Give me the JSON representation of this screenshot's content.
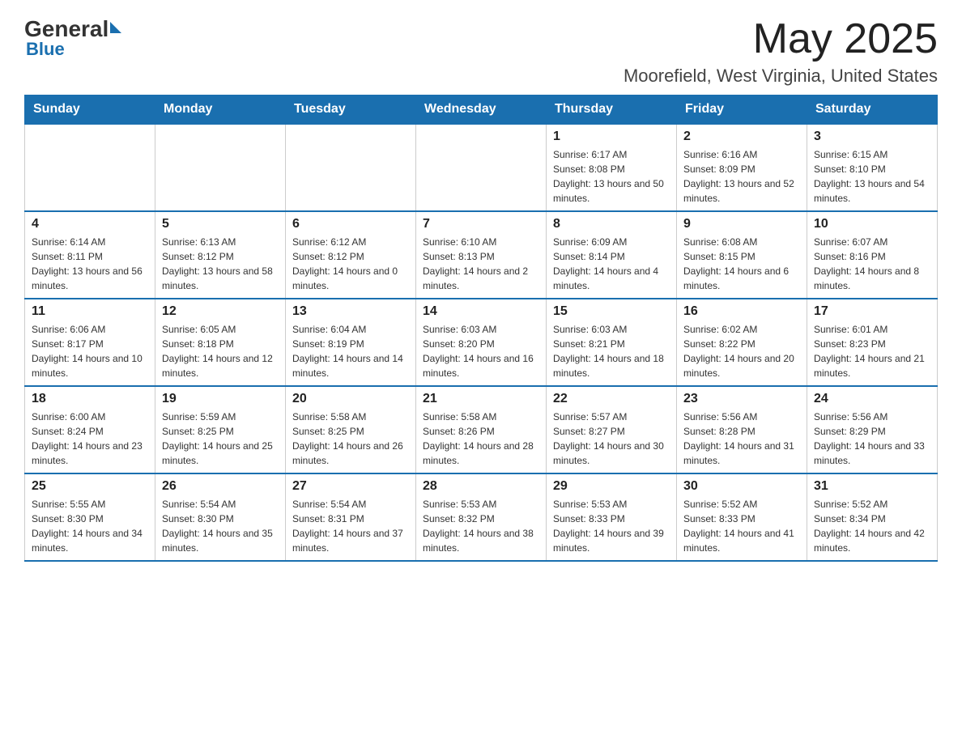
{
  "header": {
    "logo_general": "General",
    "logo_blue": "Blue",
    "month_title": "May 2025",
    "location": "Moorefield, West Virginia, United States"
  },
  "days_of_week": [
    "Sunday",
    "Monday",
    "Tuesday",
    "Wednesday",
    "Thursday",
    "Friday",
    "Saturday"
  ],
  "weeks": [
    [
      {
        "day": "",
        "info": ""
      },
      {
        "day": "",
        "info": ""
      },
      {
        "day": "",
        "info": ""
      },
      {
        "day": "",
        "info": ""
      },
      {
        "day": "1",
        "info": "Sunrise: 6:17 AM\nSunset: 8:08 PM\nDaylight: 13 hours and 50 minutes."
      },
      {
        "day": "2",
        "info": "Sunrise: 6:16 AM\nSunset: 8:09 PM\nDaylight: 13 hours and 52 minutes."
      },
      {
        "day": "3",
        "info": "Sunrise: 6:15 AM\nSunset: 8:10 PM\nDaylight: 13 hours and 54 minutes."
      }
    ],
    [
      {
        "day": "4",
        "info": "Sunrise: 6:14 AM\nSunset: 8:11 PM\nDaylight: 13 hours and 56 minutes."
      },
      {
        "day": "5",
        "info": "Sunrise: 6:13 AM\nSunset: 8:12 PM\nDaylight: 13 hours and 58 minutes."
      },
      {
        "day": "6",
        "info": "Sunrise: 6:12 AM\nSunset: 8:12 PM\nDaylight: 14 hours and 0 minutes."
      },
      {
        "day": "7",
        "info": "Sunrise: 6:10 AM\nSunset: 8:13 PM\nDaylight: 14 hours and 2 minutes."
      },
      {
        "day": "8",
        "info": "Sunrise: 6:09 AM\nSunset: 8:14 PM\nDaylight: 14 hours and 4 minutes."
      },
      {
        "day": "9",
        "info": "Sunrise: 6:08 AM\nSunset: 8:15 PM\nDaylight: 14 hours and 6 minutes."
      },
      {
        "day": "10",
        "info": "Sunrise: 6:07 AM\nSunset: 8:16 PM\nDaylight: 14 hours and 8 minutes."
      }
    ],
    [
      {
        "day": "11",
        "info": "Sunrise: 6:06 AM\nSunset: 8:17 PM\nDaylight: 14 hours and 10 minutes."
      },
      {
        "day": "12",
        "info": "Sunrise: 6:05 AM\nSunset: 8:18 PM\nDaylight: 14 hours and 12 minutes."
      },
      {
        "day": "13",
        "info": "Sunrise: 6:04 AM\nSunset: 8:19 PM\nDaylight: 14 hours and 14 minutes."
      },
      {
        "day": "14",
        "info": "Sunrise: 6:03 AM\nSunset: 8:20 PM\nDaylight: 14 hours and 16 minutes."
      },
      {
        "day": "15",
        "info": "Sunrise: 6:03 AM\nSunset: 8:21 PM\nDaylight: 14 hours and 18 minutes."
      },
      {
        "day": "16",
        "info": "Sunrise: 6:02 AM\nSunset: 8:22 PM\nDaylight: 14 hours and 20 minutes."
      },
      {
        "day": "17",
        "info": "Sunrise: 6:01 AM\nSunset: 8:23 PM\nDaylight: 14 hours and 21 minutes."
      }
    ],
    [
      {
        "day": "18",
        "info": "Sunrise: 6:00 AM\nSunset: 8:24 PM\nDaylight: 14 hours and 23 minutes."
      },
      {
        "day": "19",
        "info": "Sunrise: 5:59 AM\nSunset: 8:25 PM\nDaylight: 14 hours and 25 minutes."
      },
      {
        "day": "20",
        "info": "Sunrise: 5:58 AM\nSunset: 8:25 PM\nDaylight: 14 hours and 26 minutes."
      },
      {
        "day": "21",
        "info": "Sunrise: 5:58 AM\nSunset: 8:26 PM\nDaylight: 14 hours and 28 minutes."
      },
      {
        "day": "22",
        "info": "Sunrise: 5:57 AM\nSunset: 8:27 PM\nDaylight: 14 hours and 30 minutes."
      },
      {
        "day": "23",
        "info": "Sunrise: 5:56 AM\nSunset: 8:28 PM\nDaylight: 14 hours and 31 minutes."
      },
      {
        "day": "24",
        "info": "Sunrise: 5:56 AM\nSunset: 8:29 PM\nDaylight: 14 hours and 33 minutes."
      }
    ],
    [
      {
        "day": "25",
        "info": "Sunrise: 5:55 AM\nSunset: 8:30 PM\nDaylight: 14 hours and 34 minutes."
      },
      {
        "day": "26",
        "info": "Sunrise: 5:54 AM\nSunset: 8:30 PM\nDaylight: 14 hours and 35 minutes."
      },
      {
        "day": "27",
        "info": "Sunrise: 5:54 AM\nSunset: 8:31 PM\nDaylight: 14 hours and 37 minutes."
      },
      {
        "day": "28",
        "info": "Sunrise: 5:53 AM\nSunset: 8:32 PM\nDaylight: 14 hours and 38 minutes."
      },
      {
        "day": "29",
        "info": "Sunrise: 5:53 AM\nSunset: 8:33 PM\nDaylight: 14 hours and 39 minutes."
      },
      {
        "day": "30",
        "info": "Sunrise: 5:52 AM\nSunset: 8:33 PM\nDaylight: 14 hours and 41 minutes."
      },
      {
        "day": "31",
        "info": "Sunrise: 5:52 AM\nSunset: 8:34 PM\nDaylight: 14 hours and 42 minutes."
      }
    ]
  ]
}
